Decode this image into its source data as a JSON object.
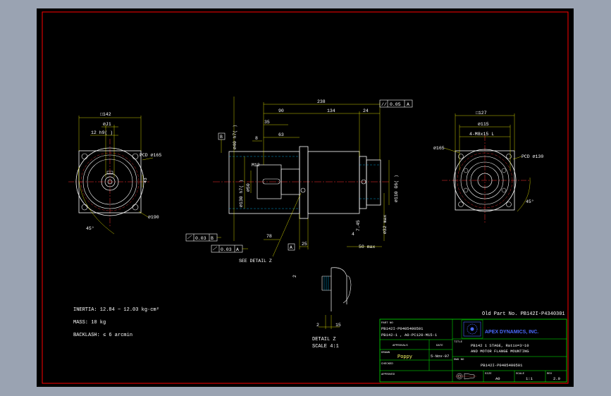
{
  "colors": {
    "sheet_bg": "#000000",
    "window_bg": "#9aa3b2",
    "border": "#ff0000",
    "part": "#ffffff",
    "dimension": "#ffff00",
    "center_line": "#ff3333",
    "hatch": "#00c0ff",
    "title_block": "#00ff00",
    "brand": "#4b6bff"
  },
  "drawing": {
    "front_view": {
      "labels": {
        "square": "□142",
        "shaft": "⌀J1",
        "key": "12 h9(    )",
        "pcd": "PCD ⌀165",
        "holes": "⌀190",
        "angle": "45°",
        "side_dim": "43"
      }
    },
    "side_view": {
      "top_dims": {
        "total": "238",
        "a": "90",
        "b": "134",
        "c": "24",
        "d": "35",
        "e": "63",
        "f": "8"
      },
      "tolerance_frame": {
        "symbol": "//",
        "value": "0.05",
        "datum": "A"
      },
      "left_dims": {
        "shaft": "⌀40 h7(    )",
        "spigot": "⌀130 h7(    )",
        "inner": "⌀50",
        "m": "M12"
      },
      "right_dims": {
        "spigot": "⌀110 G6(    )",
        "pilot": "⌀32 max",
        "depth": "50 max",
        "key": "7.45"
      },
      "bottom_dims": {
        "a": "78",
        "b": "25",
        "c": "4"
      },
      "datum_b": "B",
      "datum_a": "A",
      "frame1": {
        "value": "0.03",
        "datum": "B"
      },
      "frame2": {
        "value": "0.03",
        "datum": "A"
      },
      "callout": "SEE DETAIL Z"
    },
    "motor_view": {
      "labels": {
        "square": "□127",
        "bolt": "⌀115",
        "thread": "4-M8x15 L",
        "hole": "⌀165",
        "pcd": "PCD ⌀130",
        "angle": "45°"
      }
    },
    "detail": {
      "title": "DETAIL Z",
      "scale": "SCALE 4:1",
      "dim1": "2",
      "dim2": "2",
      "dim3": "15"
    },
    "notes": [
      "INERTIA: 12.84 ~ 12.03 kg·cm²",
      "MASS: 10 kg",
      "BACKLASH: ≤ 6 arcmin"
    ],
    "old_part": "Old Part No. PB142I-P4340301",
    "title_block": {
      "part_no_label": "PART NO",
      "part_no": [
        "PB142I-P0405400501",
        "PB142-1 , A0-PC120-M15-1"
      ],
      "approvals_label": "APPROVALS",
      "date_label": "DATE",
      "drawn_label": "DRAWN",
      "drawn": "Poppy",
      "drawn_date": "5-Nov-07",
      "checked_label": "CHECKED",
      "approved_label": "APPROVED",
      "company": "APEX DYNAMICS, INC.",
      "title_label": "TITLE",
      "title": [
        "PB142 1 STAGE, Ratio=3~10",
        "AND MOTOR FLANGE MOUNTING"
      ],
      "dwg_label": "DWG NO",
      "dwg_no": "PB142I-P0405400501",
      "size_label": "SIZE",
      "size": "A0",
      "scale_label": "SCALE",
      "scale": "1:1",
      "rev_label": "REV",
      "rev": "2.0"
    }
  }
}
